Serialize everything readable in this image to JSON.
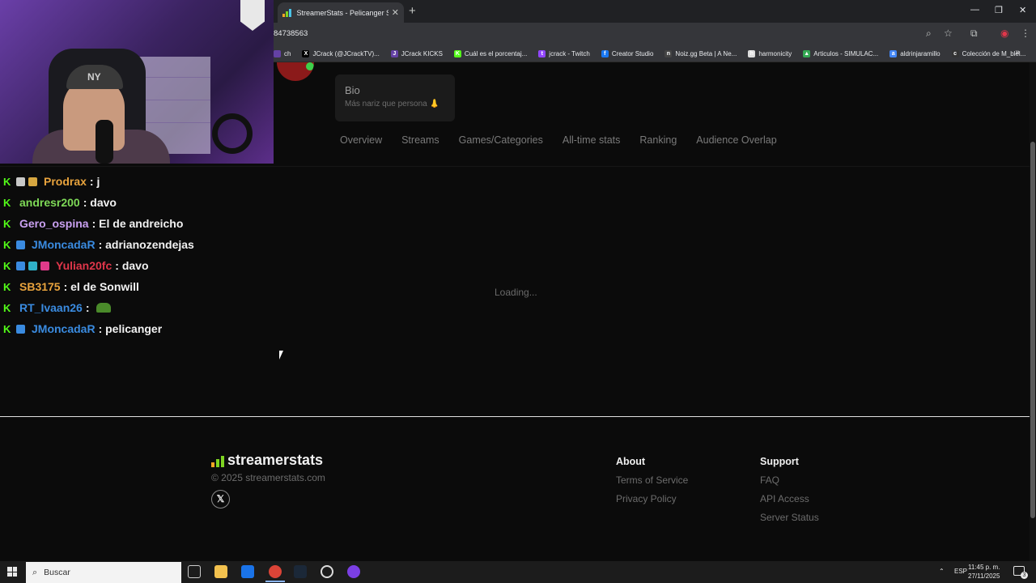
{
  "browser": {
    "tab_title": "StreamerStats - Pelicanger Stre",
    "tab_close": "✕",
    "new_tab": "+",
    "url": "84738563",
    "window_min": "—",
    "window_restore": "❐",
    "window_close": "✕",
    "bookmarks": [
      {
        "label": "ch",
        "color": "#6441a5",
        "glyph": ""
      },
      {
        "label": "JCrack (@JCrackTV)...",
        "color": "#000000",
        "glyph": "X"
      },
      {
        "label": "JCrack KICKS",
        "color": "#6441a5",
        "glyph": "J"
      },
      {
        "label": "Cuál es el porcentaj...",
        "color": "#53fc18",
        "glyph": "K"
      },
      {
        "label": "jcrack - Twitch",
        "color": "#9146ff",
        "glyph": "t"
      },
      {
        "label": "Creator Studio",
        "color": "#1877f2",
        "glyph": "f"
      },
      {
        "label": "Noiz.gg Beta | A Ne...",
        "color": "#444444",
        "glyph": "n"
      },
      {
        "label": "harmonicity",
        "color": "#dddddd",
        "glyph": "h"
      },
      {
        "label": "Articulos - SIMULAC...",
        "color": "#34a853",
        "glyph": "▲"
      },
      {
        "label": "aldrinjaramillo",
        "color": "#4285f4",
        "glyph": "a"
      },
      {
        "label": "Colección de M_blei...",
        "color": "#333333",
        "glyph": "c"
      }
    ],
    "bookmarks_more": "»"
  },
  "profile": {
    "bio_title": "Bio",
    "bio_text": "Más nariz que persona 👃"
  },
  "nav_tabs": [
    "Overview",
    "Streams",
    "Games/Categories",
    "All-time stats",
    "Ranking",
    "Audience Overlap"
  ],
  "loading_text": "Loading...",
  "chat": [
    {
      "user": "Prodrax",
      "color": "#e8a33d",
      "message": ": j",
      "badges": [
        "k",
        "e",
        "d"
      ]
    },
    {
      "user": "andresr200",
      "color": "#7ed957",
      "message": ": davo",
      "badges": [
        "k"
      ]
    },
    {
      "user": "Gero_ospina",
      "color": "#c9a0f0",
      "message": ": El de andreicho",
      "badges": [
        "k"
      ]
    },
    {
      "user": "JMoncadaR",
      "color": "#3a8be0",
      "message": ": adrianozendejas",
      "badges": [
        "k",
        "a"
      ]
    },
    {
      "user": "Yulian20fc",
      "color": "#e0364a",
      "message": ": davo",
      "badges": [
        "k",
        "a",
        "b",
        "c"
      ]
    },
    {
      "user": "SB3175",
      "color": "#e8a33d",
      "message": ": el de Sonwill",
      "badges": [
        "k"
      ]
    },
    {
      "user": "RT_Ivaan26",
      "color": "#3a8be0",
      "message": ":",
      "badges": [
        "k"
      ],
      "emote": true
    },
    {
      "user": "JMoncadaR",
      "color": "#3a8be0",
      "message": ": pelicanger",
      "badges": [
        "k",
        "a"
      ]
    }
  ],
  "webcam": {
    "cap_text": "NY"
  },
  "footer": {
    "logo_text": "streamerstats",
    "copyright": "© 2025 streamerstats.com",
    "x_icon": "𝕏",
    "about_heading": "About",
    "about_links": [
      "Terms of Service",
      "Privacy Policy"
    ],
    "support_heading": "Support",
    "support_links": [
      "FAQ",
      "API Access",
      "Server Status"
    ]
  },
  "taskbar": {
    "search_placeholder": "Buscar",
    "lang": "ESP",
    "time": "11:45 p. m.",
    "date": "27/11/2025",
    "notif_count": "3",
    "tray_up": "⌃"
  }
}
